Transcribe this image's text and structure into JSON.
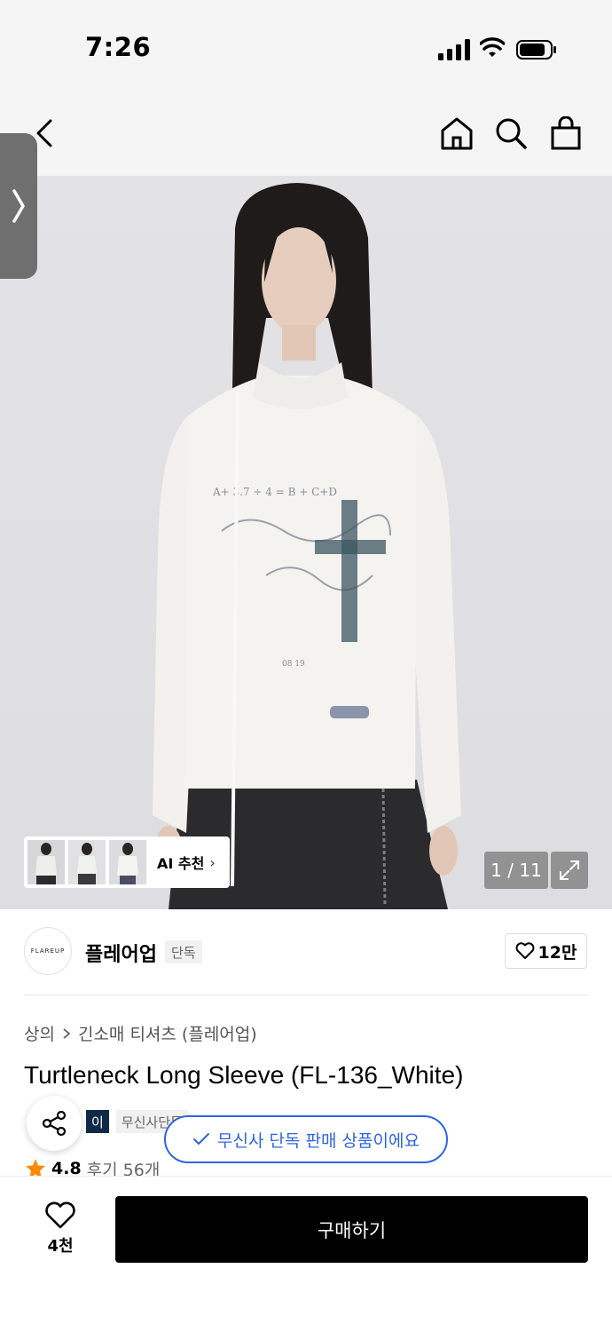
{
  "status_bar": {
    "time": "7:26"
  },
  "hero": {
    "ai_rec_label": "AI 추천",
    "counter": "1 / 11"
  },
  "brand": {
    "logo_text": "FLAREUP",
    "name": "플레어업",
    "badge": "단독",
    "likes": "12만"
  },
  "breadcrumb": {
    "level1": "상의",
    "level2": "긴소매 티셔츠 (플레어업)"
  },
  "product": {
    "title": "Turtleneck Long Sleeve (FL-136_White)",
    "tag_dark": "이",
    "tag_light": "무신사단독"
  },
  "toast": {
    "text": "무신사 단독 판매 상품이에요"
  },
  "rating": {
    "score": "4.8",
    "reviews": "후기 56개"
  },
  "bottom_bar": {
    "wish_count": "4천",
    "buy_label": "구매하기"
  },
  "colors": {
    "accent_blue": "#2f64e0",
    "star": "#ff8a00",
    "tag_dark": "#0e2a47"
  }
}
